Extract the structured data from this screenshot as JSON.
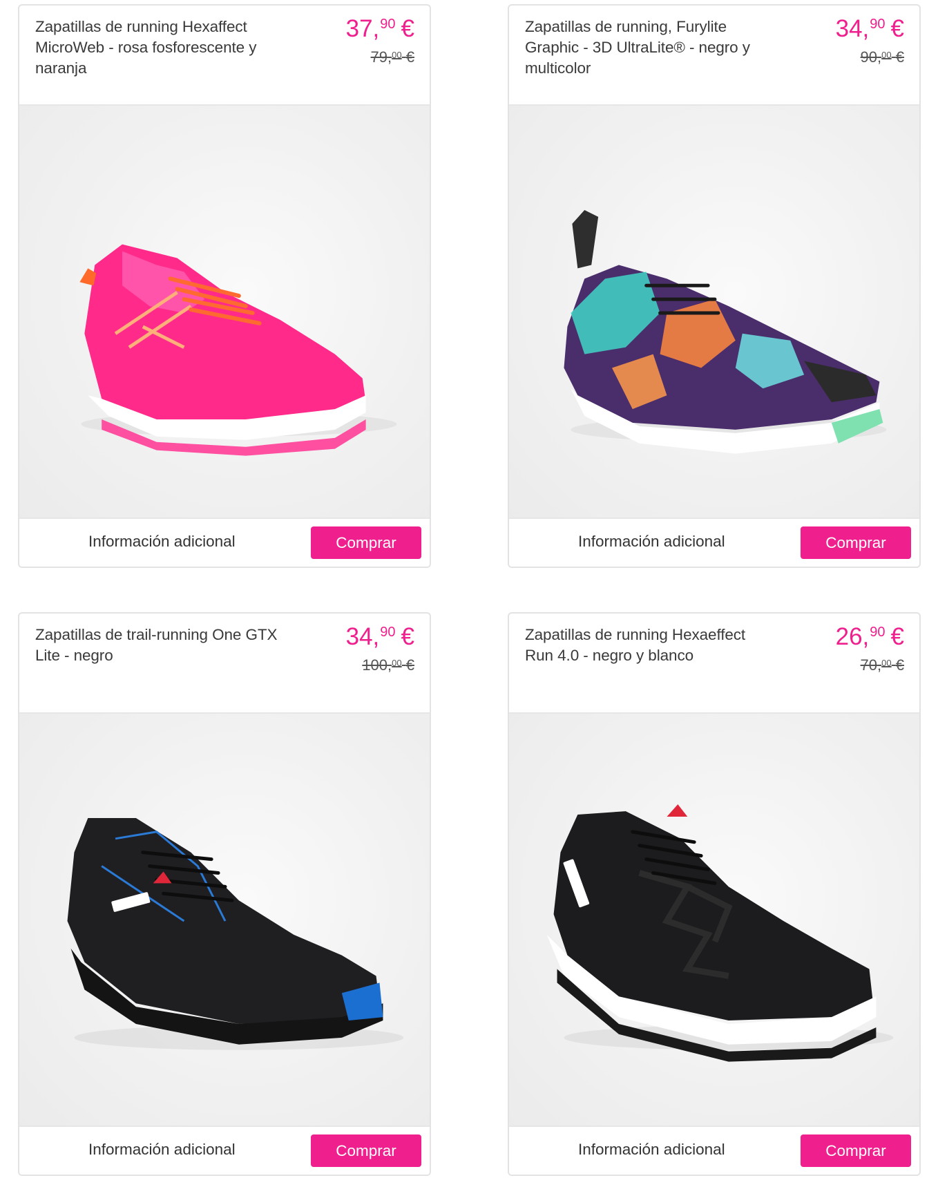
{
  "accent_color": "#ef1f8d",
  "products": [
    {
      "title": "Zapatillas de running Hexaffect MicroWeb - rosa fosforescente y naranja",
      "price_int": "37",
      "price_cents": "90",
      "currency": "€",
      "old_price_int": "79",
      "old_price_cents": "00",
      "image_icon": "pink-running-shoe-image",
      "more_info_label": "Información adicional",
      "buy_label": "Comprar"
    },
    {
      "title": "Zapatillas de running, Furylite Graphic - 3D UltraLite® - negro y multicolor",
      "price_int": "34",
      "price_cents": "90",
      "currency": "€",
      "old_price_int": "90",
      "old_price_cents": "00",
      "image_icon": "multicolor-running-shoe-image",
      "more_info_label": "Información adicional",
      "buy_label": "Comprar"
    },
    {
      "title": "Zapatillas de trail-running One GTX Lite - negro",
      "price_int": "34",
      "price_cents": "90",
      "currency": "€",
      "old_price_int": "100",
      "old_price_cents": "00",
      "image_icon": "black-trail-shoe-image",
      "more_info_label": "Información adicional",
      "buy_label": "Comprar"
    },
    {
      "title": "Zapatillas de running Hexaeffect Run 4.0 - negro y blanco",
      "price_int": "26",
      "price_cents": "90",
      "currency": "€",
      "old_price_int": "70",
      "old_price_cents": "00",
      "image_icon": "black-white-running-shoe-image",
      "more_info_label": "Información adicional",
      "buy_label": "Comprar"
    }
  ]
}
